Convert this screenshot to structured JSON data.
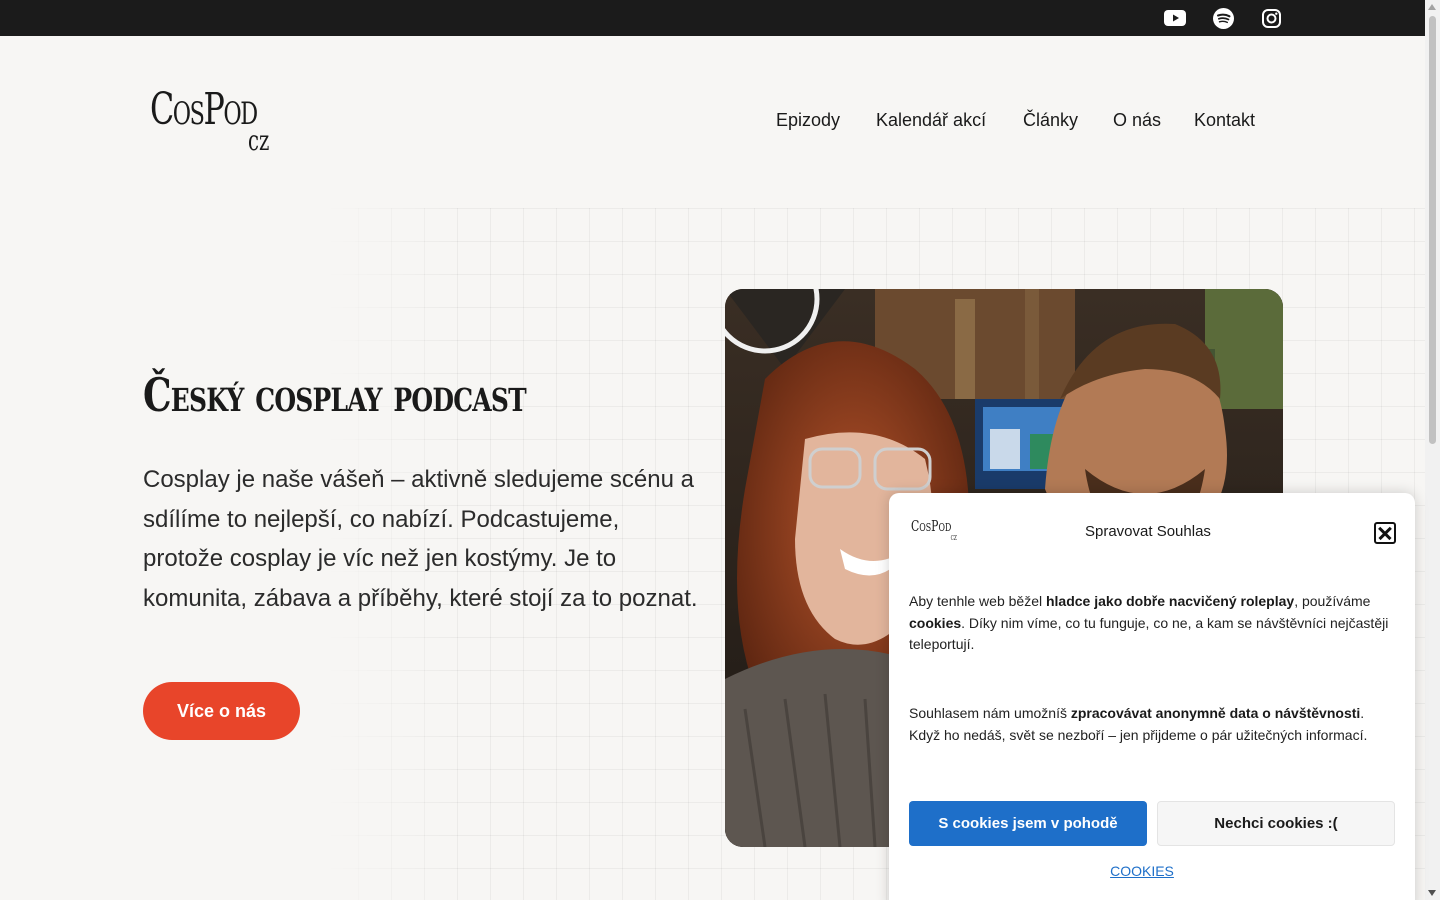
{
  "topbar": {
    "social": [
      {
        "icon": "youtube-icon",
        "label": "YouTube"
      },
      {
        "icon": "spotify-icon",
        "label": "Spotify"
      },
      {
        "icon": "instagram-icon",
        "label": "Instagram"
      }
    ]
  },
  "header": {
    "logo_main": "CosPod",
    "logo_sub": "cz",
    "nav": [
      "Epizody",
      "Kalendář akcí",
      "Články",
      "O nás",
      "Kontakt"
    ]
  },
  "hero": {
    "title": "Český cosplay podcast",
    "text": "Cosplay je naše vášeň – aktivně sledujeme scénu a sdílíme to nejlepší, co nabízí. Podcastujeme, protože cosplay je víc než jen kostýmy. Je to komunita, zábava a příběhy, které stojí za to poznat.",
    "cta": "Více o nás"
  },
  "consent": {
    "logo_main": "CosPod",
    "logo_sub": "cz",
    "title": "Spravovat Souhlas",
    "p1": {
      "a": "Aby tenhle web běžel ",
      "b": "hladce jako dobře nacvičený roleplay",
      "c": ", používáme ",
      "d": "cookies",
      "e": ". Díky nim víme, co tu funguje, co ne, a kam se návštěvníci nejčastěji teleportují."
    },
    "p2": {
      "a": "Souhlasem nám umožníš ",
      "b": "zpracovávat anonymně data o návštěvnosti",
      "c": ". Když ho nedáš, svět se nezboří – jen přijdeme o pár užitečných informací."
    },
    "accept": "S cookies jsem v pohodě",
    "deny": "Nechci cookies :(",
    "link": "COOKIES"
  },
  "colors": {
    "accent": "#e8452a",
    "consent_primary": "#1e6fc9",
    "topbar": "#1b1b1b",
    "background": "#f7f6f4"
  }
}
